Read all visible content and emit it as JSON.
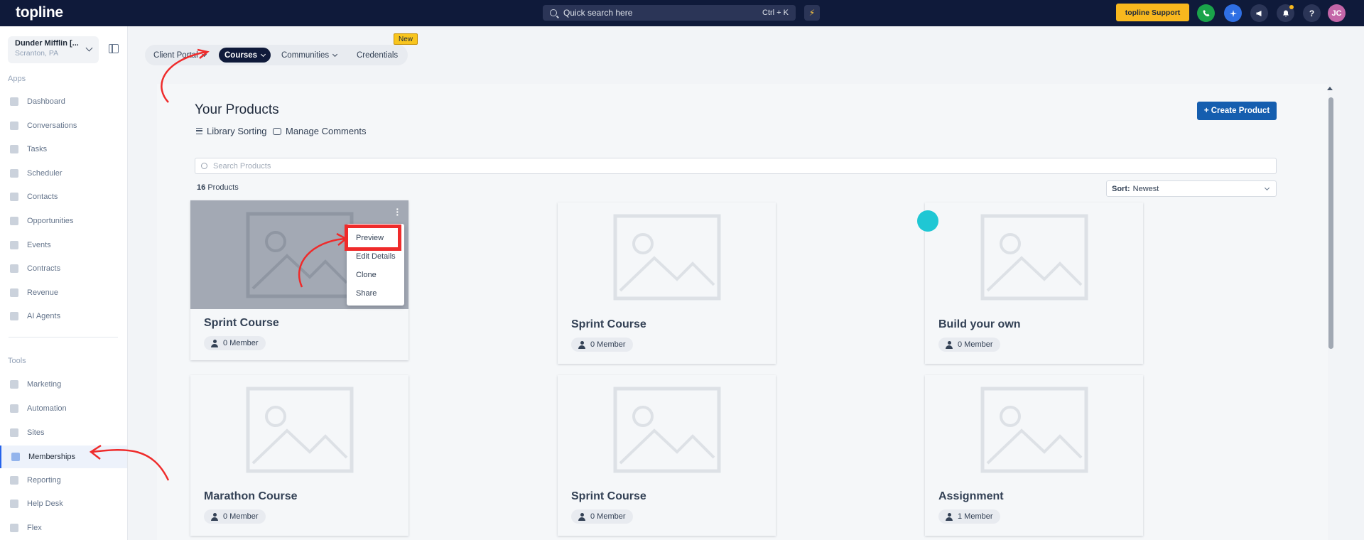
{
  "topbar": {
    "logo": "topline",
    "search_placeholder": "Quick search here",
    "search_shortcut": "Ctrl + K",
    "support_label": "topline Support",
    "avatar_initials": "JC"
  },
  "sidebar": {
    "account_name": "Dunder Mifflin [...",
    "account_location": "Scranton, PA",
    "apps_title": "Apps",
    "apps": [
      {
        "label": "Dashboard"
      },
      {
        "label": "Conversations"
      },
      {
        "label": "Tasks"
      },
      {
        "label": "Scheduler"
      },
      {
        "label": "Contacts"
      },
      {
        "label": "Opportunities"
      },
      {
        "label": "Events"
      },
      {
        "label": "Contracts"
      },
      {
        "label": "Revenue"
      },
      {
        "label": "AI Agents"
      }
    ],
    "tools_title": "Tools",
    "tools": [
      {
        "label": "Marketing"
      },
      {
        "label": "Automation"
      },
      {
        "label": "Sites"
      },
      {
        "label": "Memberships"
      },
      {
        "label": "Reporting"
      },
      {
        "label": "Help Desk"
      },
      {
        "label": "Flex"
      }
    ]
  },
  "tabs": [
    {
      "label": "Client Portal"
    },
    {
      "label": "Courses"
    },
    {
      "label": "Communities"
    },
    {
      "label": "Credentials"
    }
  ],
  "new_badge": "New",
  "main": {
    "title": "Your Products",
    "library_sorting": "Library Sorting",
    "manage_comments": "Manage Comments",
    "create_button": "+ Create Product",
    "search_placeholder": "Search Products",
    "count_number": "16",
    "count_label": "Products",
    "sort_prefix": "Sort:",
    "sort_value": "Newest"
  },
  "products": [
    {
      "name": "Sprint Course",
      "members": "0 Member"
    },
    {
      "name": "Sprint Course",
      "members": "0 Member"
    },
    {
      "name": "Build your own",
      "members": "0 Member"
    },
    {
      "name": "Marathon Course",
      "members": "0 Member"
    },
    {
      "name": "Sprint Course",
      "members": "0 Member"
    },
    {
      "name": "Assignment",
      "members": "1 Member"
    }
  ],
  "card_menu": [
    "Preview",
    "Edit Details",
    "Clone",
    "Share"
  ],
  "colors": {
    "topbar": "#0f1a3a",
    "accent_blue": "#155eaf",
    "support_yellow": "#f8b81e",
    "annotation_red": "#ef2b2b"
  }
}
